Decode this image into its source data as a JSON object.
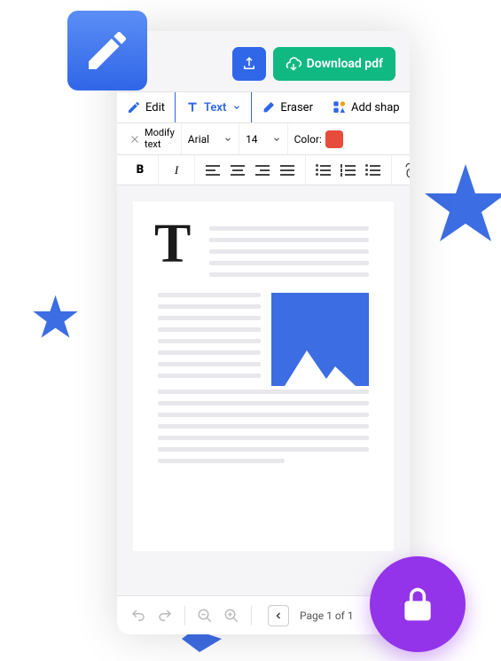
{
  "topActions": {
    "share": "share-icon",
    "download": {
      "icon": "cloud-download-icon",
      "label": "Download pdf"
    }
  },
  "toolbar": {
    "edit": {
      "icon": "pencil-icon",
      "label": "Edit"
    },
    "text": {
      "icon": "text-tool-icon",
      "label": "Text"
    },
    "eraser": {
      "icon": "eraser-icon",
      "label": "Eraser"
    },
    "addShape": {
      "icon": "shapes-icon",
      "label": "Add shap"
    }
  },
  "formatBar": {
    "close": "close-icon",
    "modify": "Modify\ntext",
    "font": "Arial",
    "size": "14",
    "colorLabel": "Color:",
    "colorValue": "#e64b3c"
  },
  "styleBar": {
    "bold": "B",
    "italic": "I",
    "link": "link-icon"
  },
  "footer": {
    "undo": "undo-icon",
    "redo": "redo-icon",
    "zoomOut": "zoom-out-icon",
    "zoomIn": "zoom-in-icon",
    "prev": "chevron-left-icon",
    "pageLabel": "Page 1 of 1"
  },
  "decorative": {
    "noteIcon": "edit-document-icon",
    "lock": "lock-icon"
  },
  "colors": {
    "primary": "#3066e8",
    "success": "#10b981",
    "purple": "#9333ea"
  }
}
